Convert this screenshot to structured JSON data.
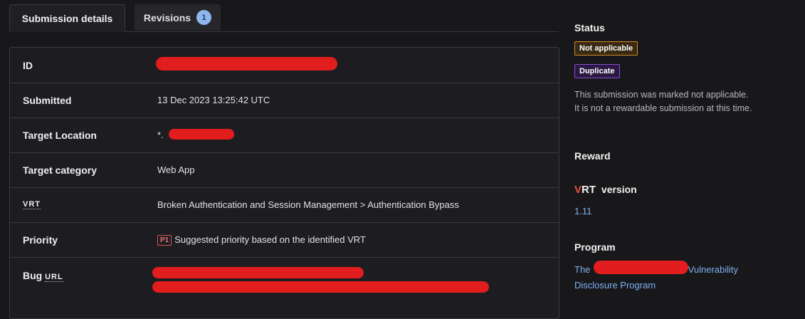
{
  "tabs": {
    "submission_details": "Submission details",
    "revisions": "Revisions",
    "revisions_count": "1"
  },
  "details": {
    "rows": [
      {
        "label": "ID",
        "value": ""
      },
      {
        "label": "Submitted",
        "value": "13 Dec 2023 13:25:42 UTC"
      },
      {
        "label": "Target Location",
        "value": "*."
      },
      {
        "label": "Target category",
        "value": "Web App"
      },
      {
        "label": "VRT",
        "value": "Broken Authentication and Session Management > Authentication Bypass"
      },
      {
        "label": "Priority",
        "value": "Suggested priority based on the identified VRT",
        "priority_badge": "P1"
      },
      {
        "label_prefix": "Bug",
        "label_abbr": "URL",
        "value": ""
      }
    ]
  },
  "sidebar": {
    "status_heading": "Status",
    "status_badges": [
      "Not applicable",
      "Duplicate"
    ],
    "status_note": "This submission was marked not applicable. It is not a rewardable submission at this time.",
    "reward_heading": "Reward",
    "vrt_logo": "VRT",
    "vrt_heading_suffix": "version",
    "vrt_version": "1.11",
    "program_heading": "Program",
    "program_link_prefix": "The",
    "program_link_suffix": "Vulnerability",
    "program_link_line2": "Disclosure Program"
  },
  "colors": {
    "background": "#18181b",
    "redaction": "#e11d1d",
    "link": "#7fb0f0",
    "not_applicable_border": "#d18a2c",
    "duplicate_border": "#8a4dd0"
  }
}
